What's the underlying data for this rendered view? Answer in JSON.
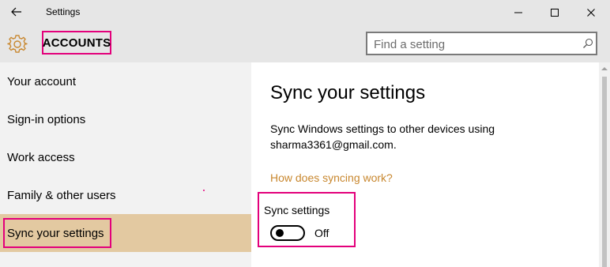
{
  "window": {
    "title": "Settings",
    "icons": {
      "back": "back-arrow-icon",
      "minimize": "minimize-icon",
      "maximize": "maximize-icon",
      "close": "close-icon"
    }
  },
  "header": {
    "section_title": "ACCOUNTS",
    "section_icon": "gear-icon",
    "search": {
      "placeholder": "Find a setting",
      "value": "",
      "icon": "search-icon"
    }
  },
  "sidebar": {
    "items": [
      {
        "label": "Your account"
      },
      {
        "label": "Sign-in options"
      },
      {
        "label": "Work access"
      },
      {
        "label": "Family & other users"
      },
      {
        "label": "Sync your settings",
        "selected": true
      }
    ]
  },
  "main": {
    "title": "Sync your settings",
    "description": "Sync Windows settings to other devices using sharma3361@gmail.com.",
    "help_link": "How does syncing work?",
    "sync_settings": {
      "label": "Sync settings",
      "state_text": "Off",
      "on": false
    }
  },
  "colors": {
    "accent": "#c8872e",
    "selected_nav": "#e3c9a1",
    "highlight_box": "#e3007b",
    "chrome": "#e6e6e6",
    "sidebar_bg": "#f2f2f2"
  }
}
